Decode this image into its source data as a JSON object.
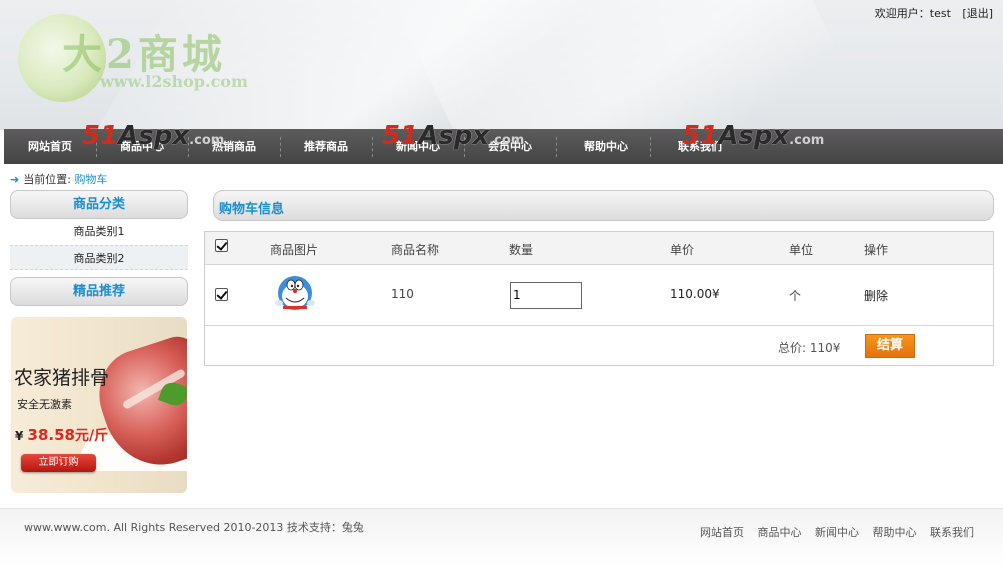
{
  "header": {
    "logo_text": "大2商城",
    "logo_url": "www.l2shop.com",
    "welcome_label": "欢迎用户：",
    "username": "test",
    "logout": "[退出]"
  },
  "nav": {
    "items": [
      {
        "label": "网站首页"
      },
      {
        "label": "商品中心"
      },
      {
        "label": "热销商品"
      },
      {
        "label": "推荐商品"
      },
      {
        "label": "新闻中心"
      },
      {
        "label": "会员中心"
      },
      {
        "label": "帮助中心"
      },
      {
        "label": "联系我们"
      }
    ],
    "watermark": {
      "n": "51",
      "s": "Aspx",
      "c": ".com"
    }
  },
  "breadcrumb": {
    "label": "当前位置:",
    "current": "购物车"
  },
  "sidebar": {
    "categories_title": "商品分类",
    "categories": [
      "商品类别1",
      "商品类别2"
    ],
    "recommend_title": "精品推荐"
  },
  "promo": {
    "title": "农家猪排骨",
    "subtitle": "安全无激素",
    "currency": "¥",
    "price": "38.58",
    "unit": "元/斤",
    "button": "立即订购"
  },
  "cart": {
    "title": "购物车信息",
    "columns": {
      "image": "商品图片",
      "name": "商品名称",
      "quantity": "数量",
      "price": "单价",
      "unit": "单位",
      "action": "操作"
    },
    "rows": [
      {
        "name": "110",
        "quantity": "1",
        "price": "110.00¥",
        "unit": "个",
        "action": "删除",
        "checked": true
      }
    ],
    "total_label": "总价:",
    "total_value": "110¥",
    "checkout": "结算"
  },
  "footer": {
    "copyright": "www.www.com. All Rights Reserved 2010-2013 技术支持：兔兔",
    "links": [
      "网站首页",
      "商品中心",
      "新闻中心",
      "帮助中心",
      "联系我们"
    ]
  },
  "colors": {
    "accent": "#1a8fd0",
    "nav_bg": "#4f4f4f",
    "checkout": "#f08a15",
    "price_red": "#e3241b"
  }
}
